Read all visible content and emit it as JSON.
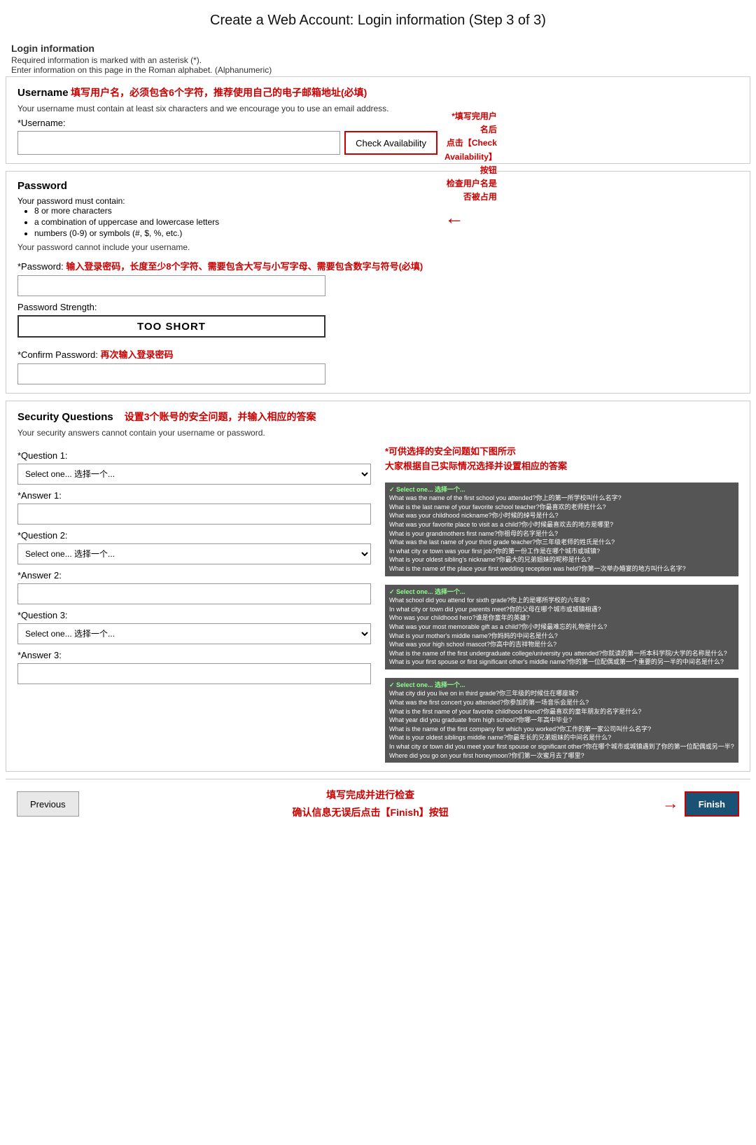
{
  "page": {
    "title": "Create a Web Account: Login information (Step 3 of 3)"
  },
  "top_notes": {
    "line1": "Login information",
    "line2": "Required information is marked with an asterisk (*).",
    "line3": "Enter information on this page in the Roman alphabet. (Alphanumeric)"
  },
  "username_section": {
    "title_prefix": "Username",
    "title_highlight": "填写用户名，必须包含6个字符，推荐使用自己的电子邮箱地址(必填)",
    "description": "Your username must contain at least six characters and we encourage you to use an email address.",
    "label": "*Username:",
    "check_btn": "Check Availability",
    "annotation_line1": "*填写完用户名后",
    "annotation_line2": "点击【Check Availability】按钮",
    "annotation_line3": "检查用户名是否被占用"
  },
  "password_section": {
    "title": "Password",
    "rules_intro": "Your password must contain:",
    "rules": [
      "8 or more characters",
      "a combination of uppercase and lowercase letters",
      "numbers (0-9) or symbols (#, $, %, etc.)"
    ],
    "no_username": "Your password cannot include your username.",
    "label_prefix": "*Password:",
    "label_highlight": "输入登录密码，长度至少8个字符、需要包含大写与小写字母、需要包含数字与符号(必填)",
    "strength_label": "Password Strength:",
    "strength_value": "TOO SHORT",
    "confirm_prefix": "*Confirm Password:",
    "confirm_highlight": "再次输入登录密码"
  },
  "security_section": {
    "title": "Security Questions",
    "title_highlight": "设置3个账号的安全问题，并输入相应的答案",
    "note": "Your security answers cannot contain your username or password.",
    "right_annotation_line1": "*可供选择的安全问题如下图所示",
    "right_annotation_line2": "大家根据自己实际情况选择并设置相应的答案",
    "q1_label": "*Question 1:",
    "q1_placeholder": "Select one...",
    "a1_label": "*Answer 1:",
    "q2_label": "*Question 2:",
    "q2_placeholder": "Select one...",
    "a2_label": "*Answer 2:",
    "q3_label": "*Question 3:",
    "q3_placeholder": "Select one...",
    "a3_label": "*Answer 3:",
    "dropdown1_items": [
      "Select one... 选择一个...",
      "What was the name of the first school you attended?你上的第一所学校叫什么名字?",
      "What is the last name of your favorite school teacher?你最喜欢的老师姓什么?",
      "What was your childhood nickname?你小时候的绰号是什么?",
      "What was your favorite place to visit as a child?你小时候最喜欢去的地方是哪里?",
      "What is your grandmothers first name?你祖母的名字是什么?",
      "What was the last name of your third grade teacher?你三年级老师的姓氏是什么?",
      "In what city or town was your first job?你的第一份工作是在哪个城市或城镇?",
      "What is your oldest sibling's nickname?你最大的兄弟姐妹的昵称是什么?",
      "What is the name of the place your first wedding reception was held?你第一次举办婚宴的地方叫什么名字?"
    ],
    "dropdown2_items": [
      "Select one... 选择一个...",
      "What school did you attend for sixth grade?你上的是哪所学校的六年级?",
      "In what city or town did your parents meet?你的父母在哪个城市或城镇相遇?",
      "Who was your childhood hero?谁是你童年的英雄?",
      "What was your most memorable gift as a child?你小时候最难忘的礼物是什么?",
      "What is your mother's middle name?你妈妈的中间名是什么?",
      "What was your high school mascot?你高中的吉祥物是什么?",
      "What is the name of the first undergraduate college/university you attended?你就读的第一所本科学院/大学的名称是什么?",
      "What is your first spouse or first significant other's middle name?你的第一位配偶或第一个重要的另一半的中间名是什么?"
    ],
    "dropdown3_items": [
      "Select one... 选择一个...",
      "What city did you live on in third grade?你三年级的时候住在哪座城?",
      "What was the first concert you attended?你参加的第一场音乐会是什么?",
      "What is the first name of your favorite childhood friend?你最喜欢的童年朋友的名字是什么?",
      "What year did you graduate from high school?你哪一年高中毕业?",
      "What is the name of the first company for which you worked?你工作的第一家公司叫什么名字?",
      "What is your oldest siblings middle name?你最年长的兄弟姐妹的中间名是什么?",
      "In what city or town did you meet your first spouse or significant other?你在哪个城市或城镇遇到了你的第一位配偶或另一半?",
      "Where did you go on your first honeymoon?你们第一次蜜月去了哪里?"
    ]
  },
  "footer": {
    "prev_label": "Previous",
    "note_line1": "填写完成并进行检查",
    "note_line2": "确认信息无误后点击【Finish】按钮",
    "finish_label": "Finish"
  }
}
